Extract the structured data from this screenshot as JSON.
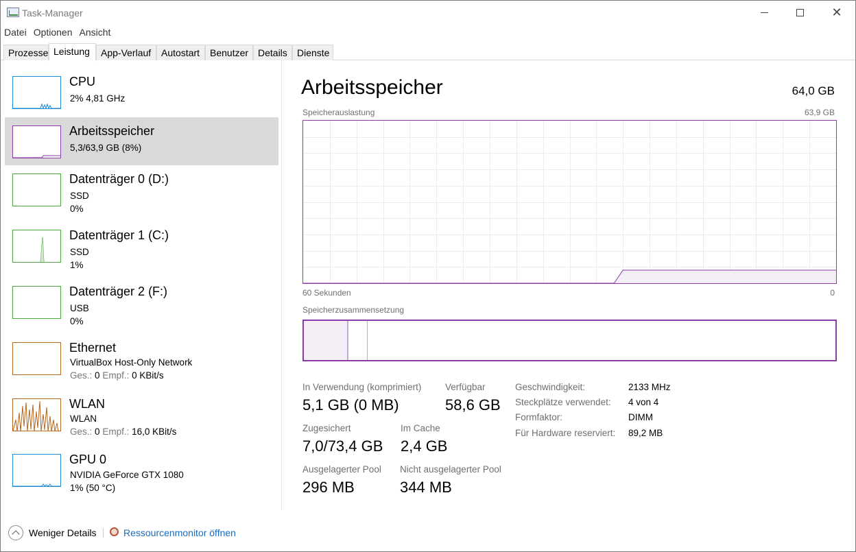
{
  "window": {
    "title": "Task-Manager"
  },
  "menu": [
    "Datei",
    "Optionen",
    "Ansicht"
  ],
  "tabs": [
    "Prozesse",
    "Leistung",
    "App-Verlauf",
    "Autostart",
    "Benutzer",
    "Details",
    "Dienste"
  ],
  "active_tab": "Leistung",
  "devices": [
    {
      "name": "CPU",
      "line1": "2%  4,81 GHz",
      "line2": "",
      "color": "#1a8ad4"
    },
    {
      "name": "Arbeitsspeicher",
      "line1": "5,3/63,9 GB (8%)",
      "line2": "",
      "color": "#8b3aa8"
    },
    {
      "name": "Datenträger 0 (D:)",
      "line1": "SSD",
      "line2": "0%",
      "color": "#4aa83a"
    },
    {
      "name": "Datenträger 1 (C:)",
      "line1": "SSD",
      "line2": "1%",
      "color": "#4aa83a"
    },
    {
      "name": "Datenträger 2 (F:)",
      "line1": "USB",
      "line2": "0%",
      "color": "#4aa83a"
    },
    {
      "name": "Ethernet",
      "line1": "VirtualBox Host-Only Network",
      "line2_label1": "Ges.:",
      "line2_val1": "0",
      "line2_label2": "Empf.:",
      "line2_val2": "0 KBit/s",
      "color": "#b5651d"
    },
    {
      "name": "WLAN",
      "line1": "WLAN",
      "line2_label1": "Ges.:",
      "line2_val1": "0",
      "line2_label2": "Empf.:",
      "line2_val2": "16,0 KBit/s",
      "color": "#b5651d"
    },
    {
      "name": "GPU 0",
      "line1": "NVIDIA GeForce GTX 1080",
      "line2": "1%  (50 °C)",
      "color": "#1a8ad4"
    }
  ],
  "selected_device": "Arbeitsspeicher",
  "main": {
    "title": "Arbeitsspeicher",
    "total": "64,0 GB",
    "usage_label": "Speicherauslastung",
    "usage_max": "63,9 GB",
    "time_left": "60 Sekunden",
    "time_right": "0",
    "composition_label": "Speicherzusammensetzung"
  },
  "stats": {
    "in_use_label": "In Verwendung (komprimiert)",
    "in_use_value": "5,1 GB (0 MB)",
    "available_label": "Verfügbar",
    "available_value": "58,6 GB",
    "committed_label": "Zugesichert",
    "committed_value": "7,0/73,4 GB",
    "cached_label": "Im Cache",
    "cached_value": "2,4 GB",
    "paged_label": "Ausgelagerter Pool",
    "paged_value": "296 MB",
    "nonpaged_label": "Nicht ausgelagerter Pool",
    "nonpaged_value": "344 MB"
  },
  "properties": [
    {
      "label": "Geschwindigkeit:",
      "value": "2133 MHz"
    },
    {
      "label": "Steckplätze verwendet:",
      "value": "4 von 4"
    },
    {
      "label": "Formfaktor:",
      "value": "DIMM"
    },
    {
      "label": "Für Hardware reserviert:",
      "value": "89,2 MB"
    }
  ],
  "footer": {
    "fewer_details": "Weniger Details",
    "resource_monitor": "Ressourcenmonitor öffnen"
  },
  "usage_series_fraction": [
    0,
    0,
    0,
    0,
    0,
    0,
    0,
    0,
    0,
    0,
    0,
    0,
    0,
    0,
    0,
    0,
    0,
    0,
    0,
    0,
    0,
    0,
    0,
    0,
    0,
    0,
    0,
    0,
    0,
    0,
    0,
    0,
    0,
    0,
    0,
    0,
    0.08,
    0.08,
    0.08,
    0.08,
    0.08,
    0.08,
    0.08,
    0.08,
    0.08,
    0.08,
    0.08,
    0.08,
    0.08,
    0.08,
    0.08,
    0.08,
    0.08,
    0.08,
    0.08,
    0.08,
    0.08,
    0.08,
    0.08,
    0.08,
    0.08
  ]
}
